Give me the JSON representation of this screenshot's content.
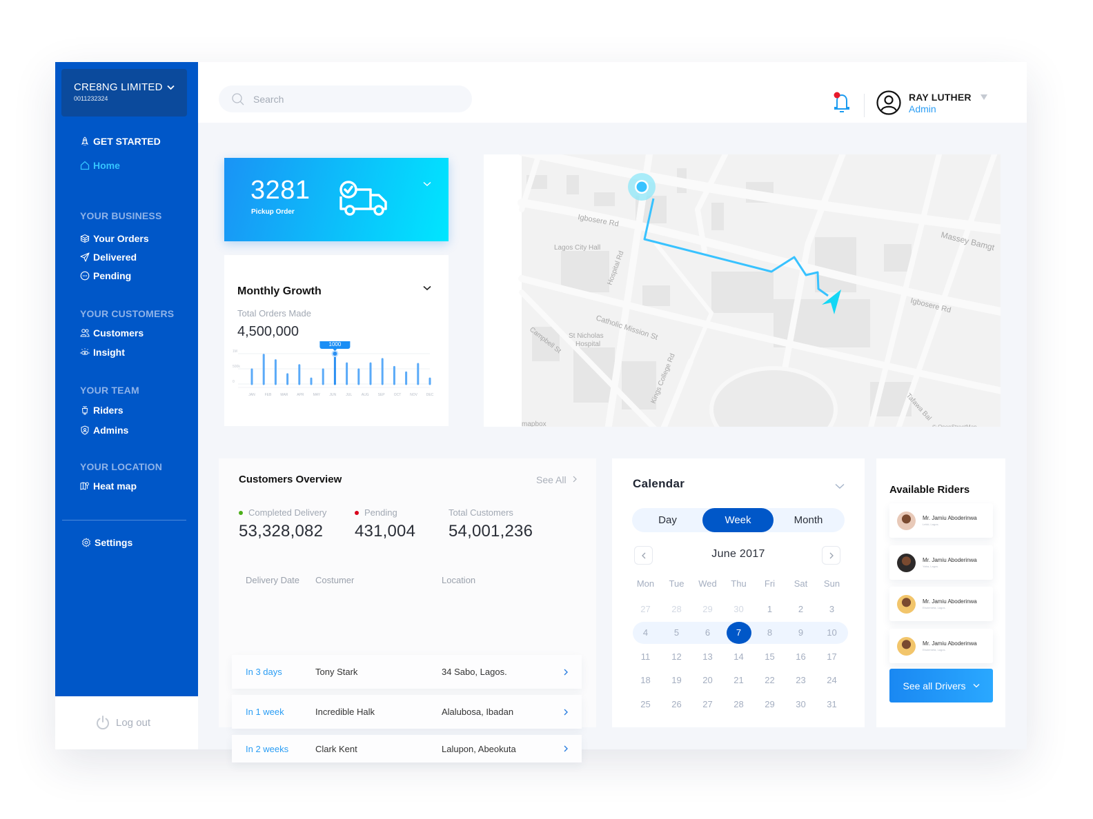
{
  "sidebar": {
    "org_name": "CRE8NG LIMITED",
    "org_id": "0011232324",
    "get_started": "GET STARTED",
    "home": "Home",
    "sections": {
      "business": "YOUR BUSINESS",
      "customers": "YOUR CUSTOMERS",
      "team": "YOUR TEAM",
      "location": "YOUR LOCATION"
    },
    "items": {
      "orders": "Your Orders",
      "delivered": "Delivered",
      "pending": "Pending",
      "customers": "Customers",
      "insight": "Insight",
      "riders": "Riders",
      "admins": "Admins",
      "heatmap": "Heat map",
      "settings": "Settings"
    },
    "logout": "Log out"
  },
  "header": {
    "search_placeholder": "Search",
    "user_name": "RAY LUTHER",
    "user_role": "Admin",
    "has_notification": true
  },
  "pickup": {
    "count": "3281",
    "label": "Pickup Order"
  },
  "growth": {
    "title": "Monthly Growth",
    "subtitle": "Total Orders Made",
    "total": "4,500,000"
  },
  "map": {
    "labels": {
      "igbosere_1": "Igbosere Rd",
      "igbosere_2": "Igbosere Rd",
      "city_hall": "Lagos City Hall",
      "hospital_rd": "Hospital Rd",
      "massey": "Massey Bamgt",
      "catholic": "Catholic Mission St",
      "st_nicholas_1": "St Nicholas",
      "st_nicholas_2": "Hospital",
      "campbell": "Campbell St",
      "kings_college": "Kings College Rd",
      "tafawa": "Tafawa Bal",
      "attrib_left": "mapbox",
      "attrib_right": "© OpenStreetMap"
    },
    "route_color": "#38c2ff"
  },
  "overview": {
    "title": "Customers Overview",
    "see_all": "See All",
    "stats": [
      {
        "label": "Completed Delivery",
        "value": "53,328,082",
        "dot": "#4caf1a"
      },
      {
        "label": "Pending",
        "value": "431,004",
        "dot": "#d9001b"
      },
      {
        "label": "Total Customers",
        "value": "54,001,236"
      }
    ],
    "columns": [
      "Delivery Date",
      "Costumer",
      "Location"
    ],
    "rows": [
      {
        "date": "In 3 days",
        "customer": "Tony Stark",
        "location": "34 Sabo, Lagos."
      },
      {
        "date": "In 1 week",
        "customer": "Incredible Halk",
        "location": "Alalubosa, Ibadan"
      },
      {
        "date": "In 2 weeks",
        "customer": "Clark Kent",
        "location": "Lalupon, Abeokuta"
      }
    ]
  },
  "calendar": {
    "title": "Calendar",
    "views": [
      "Day",
      "Week",
      "Month"
    ],
    "active_view": "Week",
    "month": "June 2017",
    "weekdays": [
      "Mon",
      "Tue",
      "Wed",
      "Thu",
      "Fri",
      "Sat",
      "Sun"
    ],
    "weeks": [
      [
        "27",
        "28",
        "29",
        "30",
        "1",
        "2",
        "3"
      ],
      [
        "4",
        "5",
        "6",
        "7",
        "8",
        "9",
        "10"
      ],
      [
        "11",
        "12",
        "13",
        "14",
        "15",
        "16",
        "17"
      ],
      [
        "18",
        "19",
        "20",
        "21",
        "22",
        "23",
        "24"
      ],
      [
        "25",
        "26",
        "27",
        "28",
        "29",
        "30",
        "31"
      ]
    ],
    "selected_day": "7",
    "highlight_week": 1
  },
  "riders": {
    "title": "Available Riders",
    "list": [
      {
        "name": "Mr. Jamiu Aboderinwa",
        "location": "Lekki, Lagos.",
        "avatar_color": "#e8c9b8"
      },
      {
        "name": "Mr. Jamiu Aboderinwa",
        "location": "Yaba, Lagos.",
        "avatar_color": "#2d2a2a"
      },
      {
        "name": "Mr. Jamiu Aboderinwa",
        "location": "Ebutemeta, Lagos.",
        "avatar_color": "#f2c56b"
      },
      {
        "name": "Mr. Jamiu Aboderinwa",
        "location": "Ebutemeta, Lagos.",
        "avatar_color": "#f2c56b"
      }
    ],
    "button": "See all Drivers"
  },
  "chart_data": {
    "type": "bar",
    "title": "Monthly Growth",
    "subtitle": "Total Orders Made",
    "xlabel": "",
    "ylabel": "",
    "tick_labels_y": [
      "1M",
      "500k",
      "0"
    ],
    "ylim": [
      0,
      1000000
    ],
    "categories": [
      "JAN",
      "FEB",
      "MAR",
      "APR",
      "MAY",
      "JUN",
      "JUL",
      "AUG",
      "SEP",
      "OCT",
      "NOV",
      "DEC"
    ],
    "values": [
      480000,
      960000,
      780000,
      320000,
      620000,
      180000,
      480000,
      1000000,
      680000,
      480000,
      680000,
      820000,
      560000,
      380000,
      660000,
      180000
    ],
    "highlight_index": 7,
    "highlight_label": "1000",
    "grid": true,
    "color": "#5aaaf8",
    "highlight_color": "#2a8ff2"
  },
  "colors": {
    "sidebar": "#0057c8",
    "accent": "#2a9df4",
    "active_nav": "#34c4ff"
  }
}
